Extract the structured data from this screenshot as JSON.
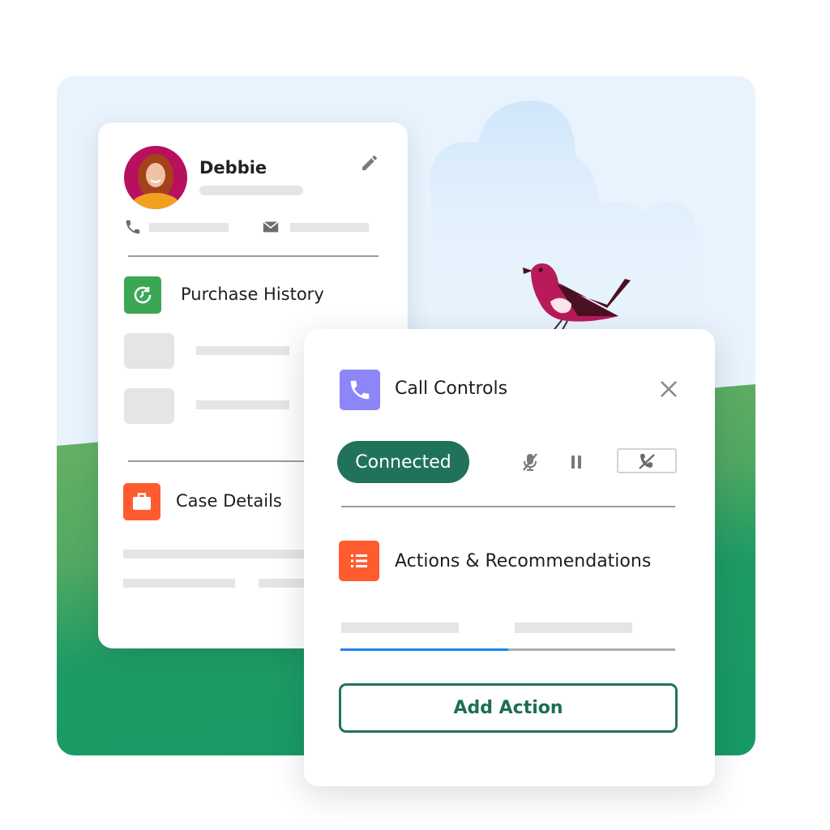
{
  "colors": {
    "sky": "#e9f3fd",
    "cloud": "#d4e9fb",
    "grass_light": "#6fb464",
    "grass_dark": "#199a64",
    "connected_bg": "#20735a",
    "purchase_icon_bg": "#3ba755",
    "case_icon_bg": "#fe5c2f",
    "call_icon_bg": "#8c86f8",
    "actions_icon_bg": "#fe5c2f",
    "progress_fill": "#1b86ee",
    "bird_body": "#b91a5a",
    "bird_wing": "#4a1123"
  },
  "profile": {
    "name": "Debbie",
    "sections": {
      "purchase_history": {
        "title": "Purchase History",
        "icon": "clock-refresh-icon"
      },
      "case_details": {
        "title": "Case Details",
        "icon": "briefcase-icon"
      }
    }
  },
  "call_controls": {
    "title": "Call Controls",
    "status": "Connected",
    "icons": [
      "phone-icon",
      "close-icon",
      "mute-icon",
      "pause-icon",
      "end-call-icon"
    ],
    "actions_title": "Actions & Recommendations",
    "tab_progress": 0.5,
    "add_action_label": "Add Action"
  }
}
